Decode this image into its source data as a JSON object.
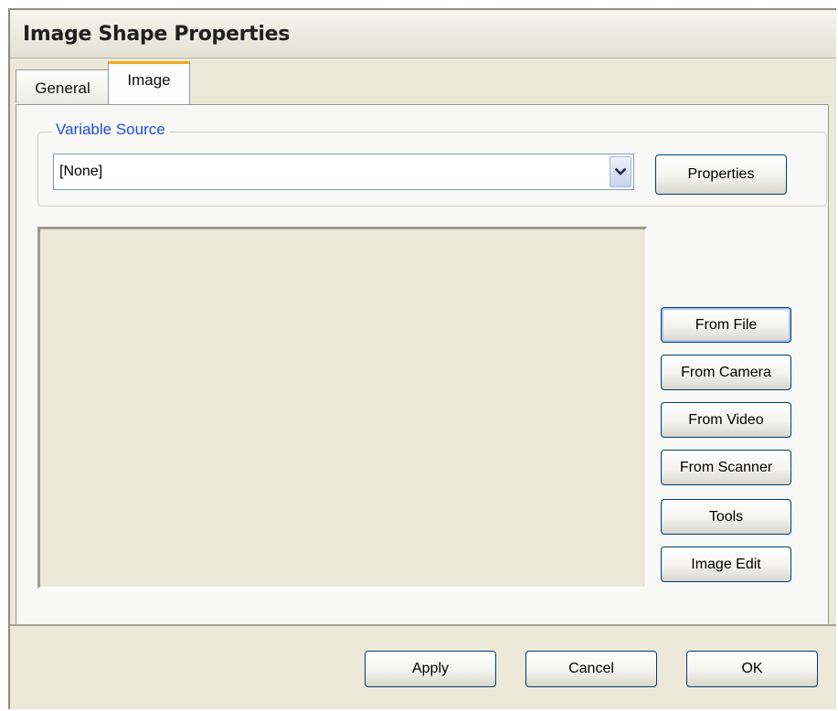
{
  "window": {
    "title": "Image Shape Properties"
  },
  "tabs": [
    {
      "label": "General",
      "selected": false
    },
    {
      "label": "Image",
      "selected": true
    }
  ],
  "variable_source": {
    "group_label": "Variable Source",
    "selected_value": "[None]",
    "properties_label": "Properties"
  },
  "image_buttons": [
    {
      "label": "From File"
    },
    {
      "label": "From Camera"
    },
    {
      "label": "From Video"
    },
    {
      "label": "From Scanner"
    },
    {
      "label": "Tools"
    },
    {
      "label": "Image Edit"
    }
  ],
  "footer": {
    "apply_label": "Apply",
    "cancel_label": "Cancel",
    "ok_label": "OK"
  },
  "icons": {
    "dropdown": "chevron-down-icon"
  },
  "colors": {
    "dialog_bg": "#ece9d8",
    "panel_bg": "#f8f8f6",
    "group_label": "#1f4fd6",
    "button_border": "#003c74",
    "tab_accent": "#f5a623"
  }
}
